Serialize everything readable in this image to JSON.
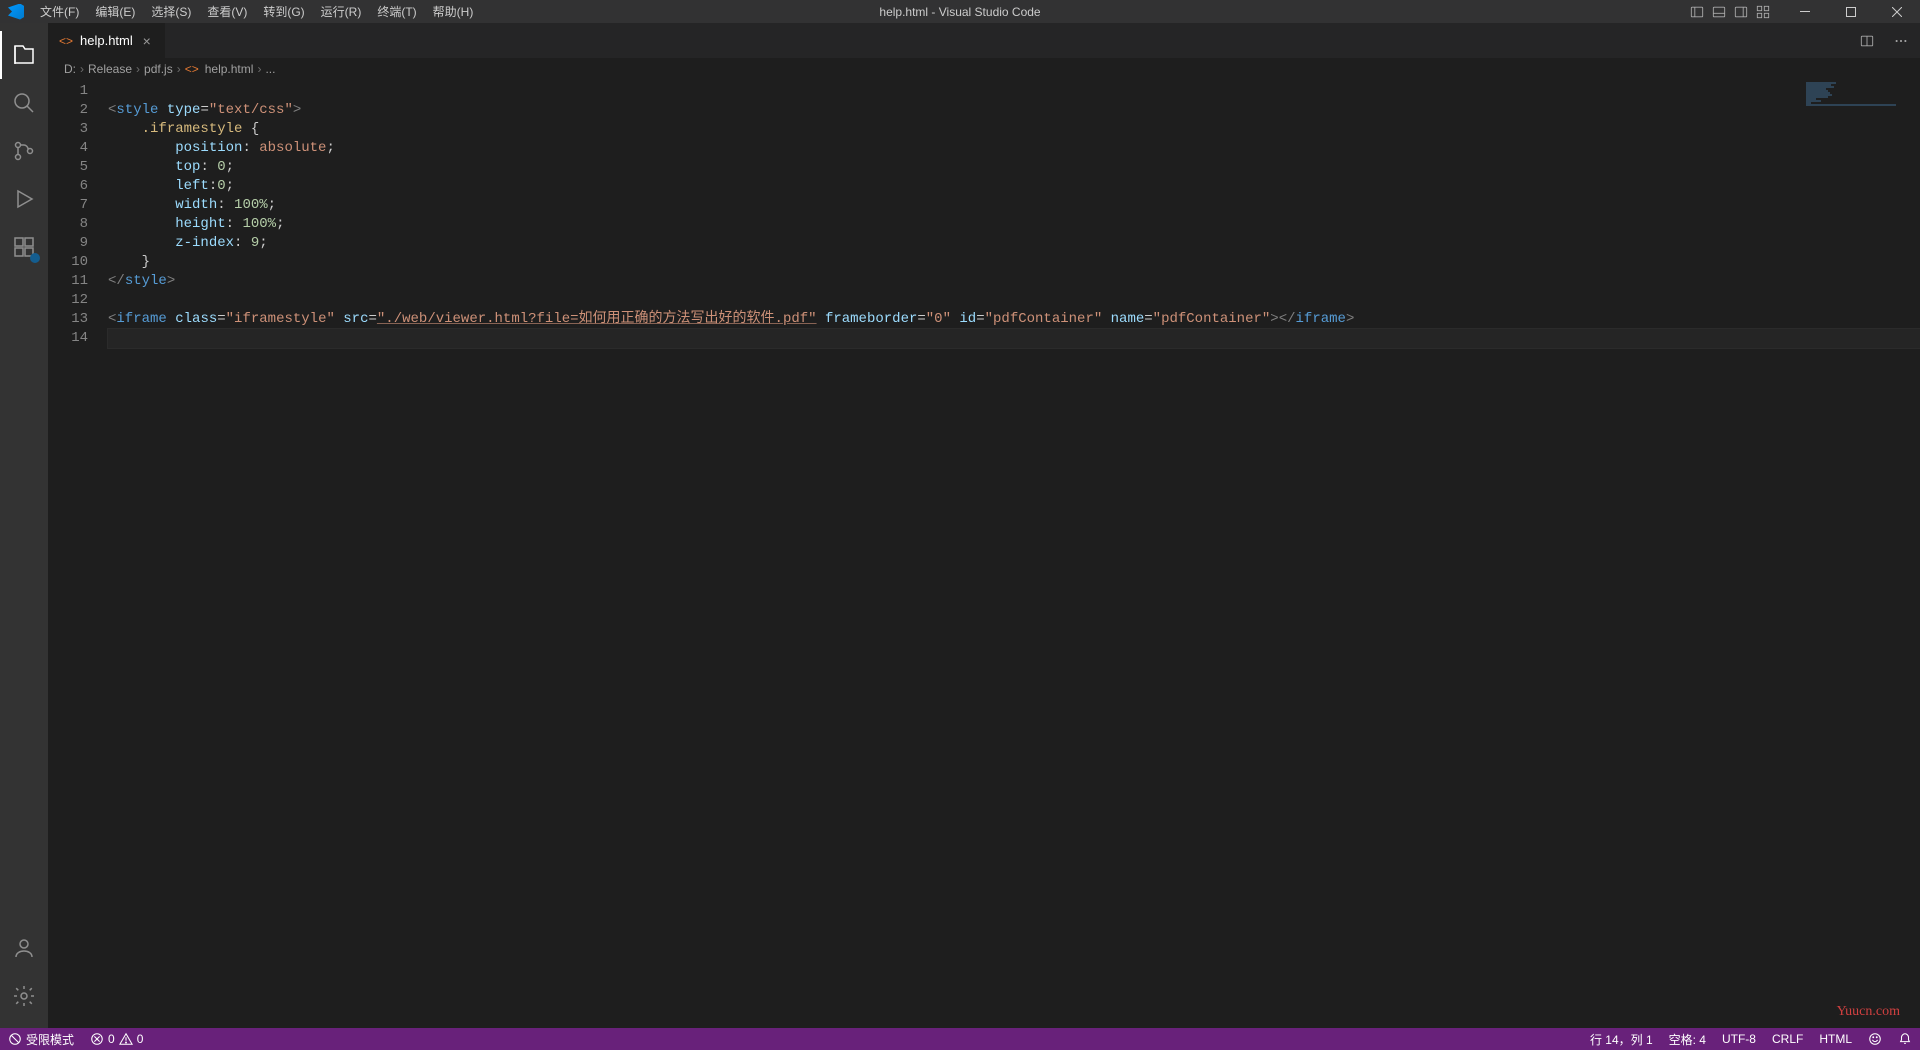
{
  "title": "help.html - Visual Studio Code",
  "menu": [
    "文件(F)",
    "编辑(E)",
    "选择(S)",
    "查看(V)",
    "转到(G)",
    "运行(R)",
    "终端(T)",
    "帮助(H)"
  ],
  "tab": {
    "label": "help.html",
    "icon": "<>"
  },
  "breadcrumbs": [
    "D:",
    "Release",
    "pdf.js",
    "help.html",
    "..."
  ],
  "lines": [
    1,
    2,
    3,
    4,
    5,
    6,
    7,
    8,
    9,
    10,
    11,
    12,
    13,
    14
  ],
  "code": {
    "l2": {
      "tag_open": "<",
      "tag": "style",
      "sp": " ",
      "attr": "type",
      "eq": "=",
      "val": "\"text/css\"",
      "tag_close": ">"
    },
    "l3": {
      "indent": "    ",
      "sel": ".iframestyle",
      "sp": " ",
      "brace": "{"
    },
    "l4": {
      "indent": "        ",
      "prop": "position",
      "colon": ": ",
      "val": "absolute",
      "semi": ";"
    },
    "l5": {
      "indent": "        ",
      "prop": "top",
      "colon": ": ",
      "val": "0",
      "semi": ";"
    },
    "l6": {
      "indent": "        ",
      "prop": "left",
      "colon": ":",
      "val": "0",
      "semi": ";"
    },
    "l7": {
      "indent": "        ",
      "prop": "width",
      "colon": ": ",
      "val": "100%",
      "semi": ";"
    },
    "l8": {
      "indent": "        ",
      "prop": "height",
      "colon": ": ",
      "val": "100%",
      "semi": ";"
    },
    "l9": {
      "indent": "        ",
      "prop": "z-index",
      "colon": ": ",
      "val": "9",
      "semi": ";"
    },
    "l10": {
      "indent": "    ",
      "brace": "}"
    },
    "l11": {
      "tag_open": "</",
      "tag": "style",
      "tag_close": ">"
    },
    "l13": {
      "open": "<",
      "tag": "iframe",
      "sp": " ",
      "a1": "class",
      "v1": "\"iframestyle\"",
      "a2": "src",
      "v2": "\"./web/viewer.html?file=如何用正确的方法写出好的软件.pdf\"",
      "a3": "frameborder",
      "v3": "\"0\"",
      "a4": "id",
      "v4": "\"pdfContainer\"",
      "a5": "name",
      "v5": "\"pdfContainer\"",
      "close1": ">",
      "close_open": "</",
      "close_tag": "iframe",
      "close2": ">"
    }
  },
  "status": {
    "restricted": "受限模式",
    "errors": "0",
    "warnings": "0",
    "cursor": "行 14，列 1",
    "spaces": "空格: 4",
    "encoding": "UTF-8",
    "eol": "CRLF",
    "lang": "HTML"
  },
  "watermark": "Yuucn.com"
}
